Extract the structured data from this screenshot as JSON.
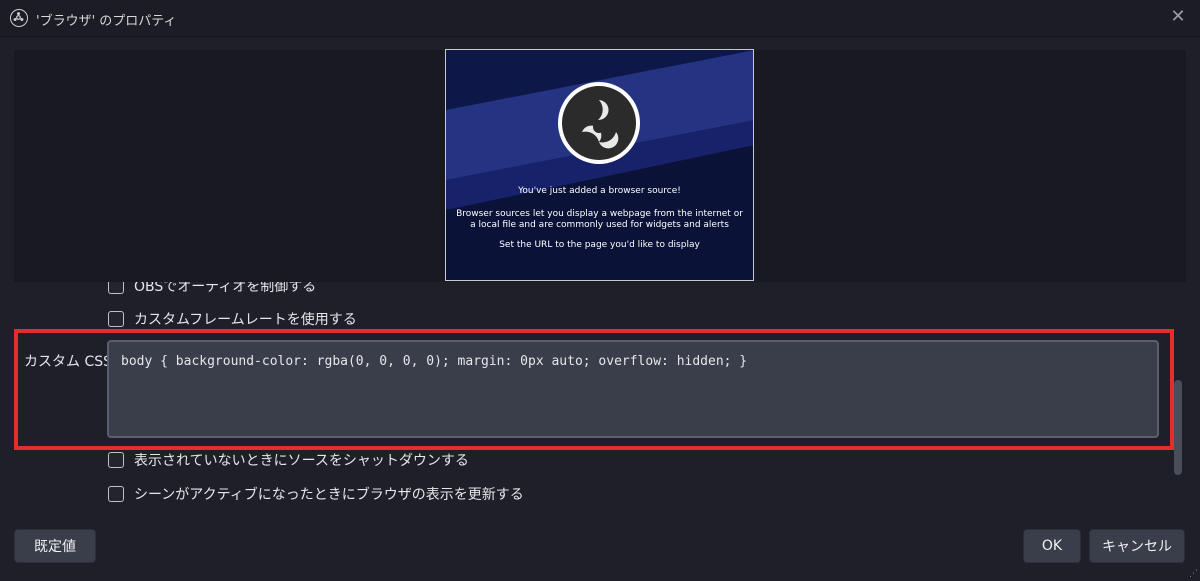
{
  "window": {
    "title": "'ブラウザ' のプロパティ",
    "icon": "obs-logo-icon",
    "close_icon": "close-icon"
  },
  "preview": {
    "line1": "You've just added a browser source!",
    "line2": "Browser sources let you display a webpage from the internet or",
    "line3": "a local file and are commonly used for widgets and alerts",
    "line4": "Set the URL to the page you'd like to display",
    "colors": {
      "background": "#0c1540",
      "stripe": "#2a3a8a"
    }
  },
  "properties": {
    "control_audio": {
      "label": "OBSでオーディオを制御する",
      "checked": false
    },
    "custom_framerate": {
      "label": "カスタムフレームレートを使用する",
      "checked": false
    },
    "custom_css": {
      "label": "カスタム CSS",
      "value": "body { background-color: rgba(0, 0, 0, 0); margin: 0px auto; overflow: hidden; }"
    },
    "shutdown_when_hidden": {
      "label": "表示されていないときにソースをシャットダウンする",
      "checked": false
    },
    "refresh_on_active": {
      "label": "シーンがアクティブになったときにブラウザの表示を更新する",
      "checked": false
    }
  },
  "buttons": {
    "defaults": "既定値",
    "ok": "OK",
    "cancel": "キャンセル"
  },
  "highlight_color": "#e52d2d"
}
